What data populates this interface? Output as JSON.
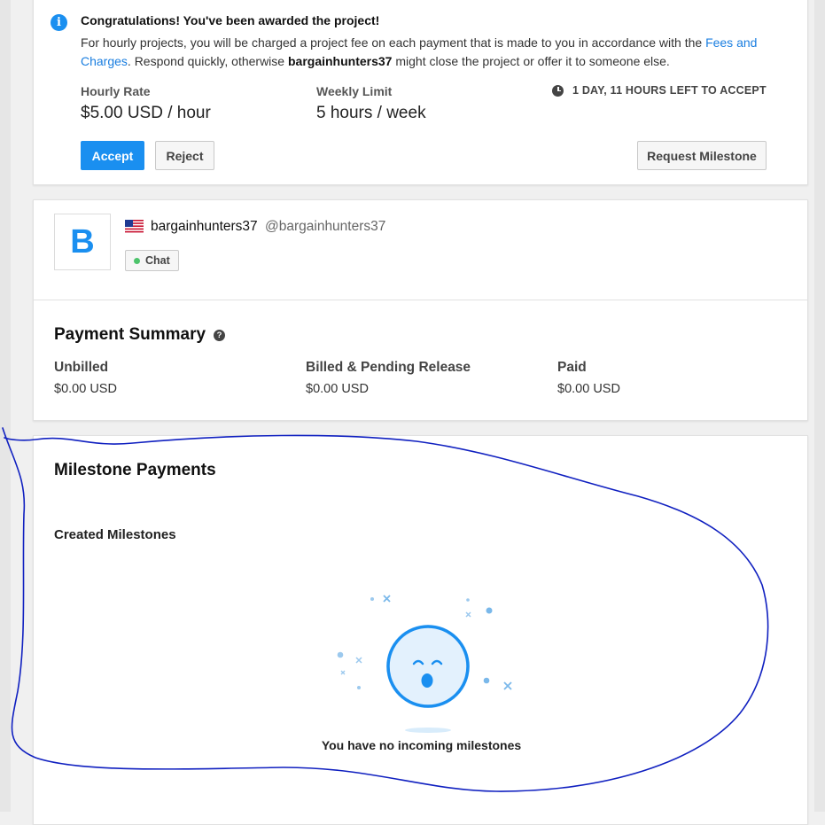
{
  "award": {
    "title": "Congratulations! You've been awarded the project!",
    "desc_part1": "For hourly projects, you will be charged a project fee on each payment that is made to you in accordance with the ",
    "desc_link": "Fees and Charges",
    "desc_part2": ". Respond quickly, otherwise ",
    "desc_user": "bargainhunters37",
    "desc_part3": " might close the project or offer it to someone else.",
    "hourly_rate_label": "Hourly Rate",
    "hourly_rate_value": "$5.00 USD / hour",
    "weekly_limit_label": "Weekly Limit",
    "weekly_limit_value": "5 hours / week",
    "deadline": "1 DAY, 11 HOURS LEFT TO ACCEPT",
    "accept_label": "Accept",
    "reject_label": "Reject",
    "request_milestone_label": "Request Milestone"
  },
  "employer": {
    "avatar_letter": "B",
    "username": "bargainhunters37",
    "handle": "@bargainhunters37",
    "chat_label": "Chat"
  },
  "payment_summary": {
    "title": "Payment Summary",
    "help_glyph": "?",
    "items": [
      {
        "label": "Unbilled",
        "value": "$0.00 USD"
      },
      {
        "label": "Billed & Pending Release",
        "value": "$0.00 USD"
      },
      {
        "label": "Paid",
        "value": "$0.00 USD"
      }
    ]
  },
  "milestones": {
    "title": "Milestone Payments",
    "subtitle": "Created Milestones",
    "empty_text": "You have no incoming milestones"
  },
  "colors": {
    "accent": "#1a8ff0",
    "annotation": "#1020c0",
    "online": "#4cc36b"
  }
}
